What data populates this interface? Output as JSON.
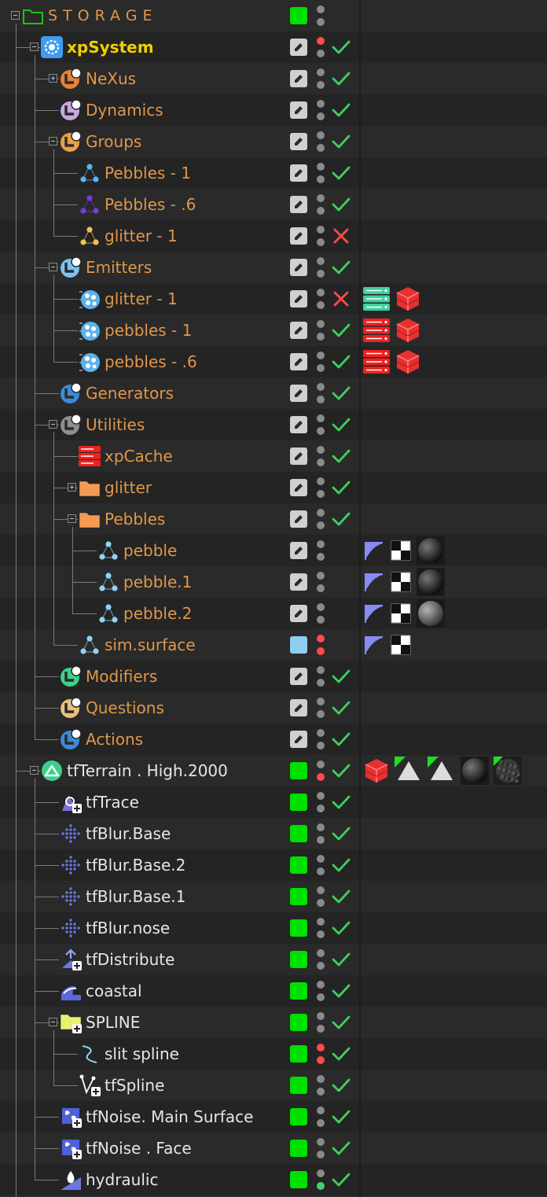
{
  "colors": {
    "background": "#2a2a2a",
    "row_alt": "#242424",
    "label_orange": "#e0974a",
    "label_yellow": "#f0d000",
    "label_white": "#e6e6e6",
    "layer_green": "#00e000",
    "check_green": "#3fd05a",
    "cross_red": "#ff4b4b",
    "dot_gray": "#8a8a8a",
    "dot_red": "#ff4b4b",
    "dot_green": "#3fd07a"
  },
  "rows": [
    {
      "label": "STORAGE",
      "style": "storage",
      "depth": 0,
      "exp": "minus",
      "icon": "folder-icon",
      "layer": "green",
      "top": "gray",
      "bottom": "gray",
      "check": "none",
      "tags": []
    },
    {
      "label": "xpSystem",
      "style": "yellow",
      "depth": 1,
      "exp": "minus",
      "icon": "xp-system-icon",
      "layer": "edit",
      "top": "red",
      "bottom": "gray",
      "check": "check",
      "tags": []
    },
    {
      "label": "NeXus",
      "style": "orange",
      "depth": 2,
      "exp": "plus",
      "icon": "nexus-icon",
      "layer": "edit",
      "top": "gray",
      "bottom": "gray",
      "check": "check",
      "tags": []
    },
    {
      "label": "Dynamics",
      "style": "orange",
      "depth": 2,
      "exp": "none",
      "icon": "dynamics-icon",
      "layer": "edit",
      "top": "gray",
      "bottom": "gray",
      "check": "check",
      "tags": []
    },
    {
      "label": "Groups",
      "style": "orange",
      "depth": 2,
      "exp": "minus",
      "icon": "groups-icon",
      "layer": "edit",
      "top": "gray",
      "bottom": "gray",
      "check": "check",
      "tags": []
    },
    {
      "label": "Pebbles - 1",
      "style": "orange",
      "depth": 3,
      "exp": "none",
      "icon": "group-blue-icon",
      "layer": "edit",
      "top": "gray",
      "bottom": "gray",
      "check": "check",
      "tags": []
    },
    {
      "label": "Pebbles  - .6",
      "style": "orange",
      "depth": 3,
      "exp": "none",
      "icon": "group-purple-icon",
      "layer": "edit",
      "top": "gray",
      "bottom": "gray",
      "check": "check",
      "tags": []
    },
    {
      "label": "glitter - 1",
      "style": "orange",
      "depth": 3,
      "exp": "none",
      "icon": "group-yellow-icon",
      "layer": "edit",
      "top": "gray",
      "bottom": "gray",
      "check": "cross",
      "tags": []
    },
    {
      "label": "Emitters",
      "style": "orange",
      "depth": 2,
      "exp": "minus",
      "icon": "emitters-icon",
      "layer": "edit",
      "top": "gray",
      "bottom": "gray",
      "check": "check",
      "tags": []
    },
    {
      "label": "glitter - 1",
      "style": "orange",
      "depth": 3,
      "exp": "none",
      "icon": "emitter-icon",
      "layer": "edit",
      "top": "gray",
      "bottom": "gray",
      "check": "cross",
      "tags": [
        "cache-teal-tag",
        "redshift-tag"
      ]
    },
    {
      "label": "pebbles - 1",
      "style": "orange",
      "depth": 3,
      "exp": "none",
      "icon": "emitter-icon",
      "layer": "edit",
      "top": "gray",
      "bottom": "gray",
      "check": "check",
      "tags": [
        "cache-red-tag",
        "redshift-tag"
      ]
    },
    {
      "label": "pebbles - .6",
      "style": "orange",
      "depth": 3,
      "exp": "none",
      "icon": "emitter-icon",
      "layer": "edit",
      "top": "gray",
      "bottom": "gray",
      "check": "check",
      "tags": [
        "cache-red-tag",
        "redshift-tag"
      ]
    },
    {
      "label": "Generators",
      "style": "orange",
      "depth": 2,
      "exp": "none",
      "icon": "generators-icon",
      "layer": "edit",
      "top": "gray",
      "bottom": "gray",
      "check": "check",
      "tags": []
    },
    {
      "label": "Utilities",
      "style": "orange",
      "depth": 2,
      "exp": "minus",
      "icon": "utilities-icon",
      "layer": "edit",
      "top": "gray",
      "bottom": "gray",
      "check": "check",
      "tags": []
    },
    {
      "label": "xpCache",
      "style": "orange",
      "depth": 3,
      "exp": "none",
      "icon": "xpcache-icon",
      "layer": "edit",
      "top": "gray",
      "bottom": "gray",
      "check": "check",
      "tags": []
    },
    {
      "label": "glitter",
      "style": "orange",
      "depth": 3,
      "exp": "plus",
      "icon": "folder-orange-icon",
      "layer": "edit",
      "top": "gray",
      "bottom": "gray",
      "check": "check",
      "tags": []
    },
    {
      "label": "Pebbles",
      "style": "orange",
      "depth": 3,
      "exp": "minus",
      "icon": "folder-orange-icon",
      "layer": "edit",
      "top": "gray",
      "bottom": "gray",
      "check": "check",
      "tags": []
    },
    {
      "label": "pebble",
      "style": "orange",
      "depth": 4,
      "exp": "none",
      "icon": "mesh-icon",
      "layer": "edit",
      "top": "gray",
      "bottom": "gray",
      "check": "none",
      "tags": [
        "uvw-tag",
        "checker-tag",
        "material-dark-tag"
      ]
    },
    {
      "label": "pebble.1",
      "style": "orange",
      "depth": 4,
      "exp": "none",
      "icon": "mesh-icon",
      "layer": "edit",
      "top": "gray",
      "bottom": "gray",
      "check": "none",
      "tags": [
        "uvw-tag",
        "checker-tag",
        "material-dark-tag"
      ]
    },
    {
      "label": "pebble.2",
      "style": "orange",
      "depth": 4,
      "exp": "none",
      "icon": "mesh-icon",
      "layer": "edit",
      "top": "gray",
      "bottom": "gray",
      "check": "none",
      "tags": [
        "uvw-tag",
        "checker-tag",
        "material-gray-tag"
      ]
    },
    {
      "label": "sim.surface",
      "style": "orange",
      "depth": 3,
      "exp": "none",
      "icon": "mesh-icon",
      "layer": "lightblue",
      "top": "red",
      "bottom": "red",
      "check": "none",
      "tags": [
        "uvw-tag",
        "checker-tag"
      ]
    },
    {
      "label": "Modifiers",
      "style": "orange",
      "depth": 2,
      "exp": "none",
      "icon": "modifiers-icon",
      "layer": "edit",
      "top": "gray",
      "bottom": "gray",
      "check": "check",
      "tags": []
    },
    {
      "label": "Questions",
      "style": "orange",
      "depth": 2,
      "exp": "none",
      "icon": "questions-icon",
      "layer": "edit",
      "top": "gray",
      "bottom": "gray",
      "check": "check",
      "tags": []
    },
    {
      "label": "Actions",
      "style": "orange",
      "depth": 2,
      "exp": "none",
      "icon": "actions-icon",
      "layer": "edit",
      "top": "gray",
      "bottom": "gray",
      "check": "check",
      "tags": []
    },
    {
      "label": "tfTerrain . High.2000",
      "style": "white",
      "depth": 1,
      "exp": "minus",
      "icon": "terrain-icon",
      "layer": "green",
      "top": "gray",
      "bottom": "red",
      "check": "check",
      "tags": [
        "redshift-tag",
        "display-tag",
        "display-tag",
        "material-dark-tag",
        "material-noise-tag"
      ]
    },
    {
      "label": "tfTrace",
      "style": "white",
      "depth": 2,
      "exp": "none",
      "icon": "trace-icon",
      "layer": "green",
      "top": "gray",
      "bottom": "gray",
      "check": "check",
      "tags": []
    },
    {
      "label": "tfBlur.Base",
      "style": "white",
      "depth": 2,
      "exp": "none",
      "icon": "blur-icon",
      "layer": "green",
      "top": "gray",
      "bottom": "gray",
      "check": "check",
      "tags": []
    },
    {
      "label": "tfBlur.Base.2",
      "style": "white",
      "depth": 2,
      "exp": "none",
      "icon": "blur-icon",
      "layer": "green",
      "top": "gray",
      "bottom": "gray",
      "check": "check",
      "tags": []
    },
    {
      "label": "tfBlur.Base.1",
      "style": "white",
      "depth": 2,
      "exp": "none",
      "icon": "blur-icon",
      "layer": "green",
      "top": "gray",
      "bottom": "gray",
      "check": "check",
      "tags": []
    },
    {
      "label": "tfBlur.nose",
      "style": "white",
      "depth": 2,
      "exp": "none",
      "icon": "blur-icon",
      "layer": "green",
      "top": "gray",
      "bottom": "gray",
      "check": "check",
      "tags": []
    },
    {
      "label": "tfDistribute",
      "style": "white",
      "depth": 2,
      "exp": "none",
      "icon": "distribute-icon",
      "layer": "green",
      "top": "gray",
      "bottom": "gray",
      "check": "check",
      "tags": []
    },
    {
      "label": "coastal",
      "style": "white",
      "depth": 2,
      "exp": "none",
      "icon": "coastal-icon",
      "layer": "green",
      "top": "gray",
      "bottom": "gray",
      "check": "check",
      "tags": []
    },
    {
      "label": "SPLINE",
      "style": "white",
      "depth": 2,
      "exp": "minus",
      "icon": "folder-yellow-icon",
      "layer": "green",
      "top": "gray",
      "bottom": "gray",
      "check": "check",
      "tags": []
    },
    {
      "label": "slit spline",
      "style": "white",
      "depth": 3,
      "exp": "none",
      "icon": "spline-icon",
      "layer": "green",
      "top": "red",
      "bottom": "red",
      "check": "check",
      "tags": []
    },
    {
      "label": "tfSpline",
      "style": "white",
      "depth": 3,
      "exp": "none",
      "icon": "tfspline-icon",
      "layer": "green",
      "top": "gray",
      "bottom": "gray",
      "check": "check",
      "tags": []
    },
    {
      "label": "tfNoise. Main Surface",
      "style": "white",
      "depth": 2,
      "exp": "none",
      "icon": "noise-icon",
      "layer": "green",
      "top": "gray",
      "bottom": "gray",
      "check": "check",
      "tags": []
    },
    {
      "label": "tfNoise . Face",
      "style": "white",
      "depth": 2,
      "exp": "none",
      "icon": "noise-icon",
      "layer": "green",
      "top": "gray",
      "bottom": "gray",
      "check": "check",
      "tags": []
    },
    {
      "label": "hydraulic",
      "style": "white",
      "depth": 2,
      "exp": "none",
      "icon": "hydraulic-icon",
      "layer": "green",
      "top": "gray",
      "bottom": "green",
      "check": "check",
      "tags": []
    }
  ]
}
